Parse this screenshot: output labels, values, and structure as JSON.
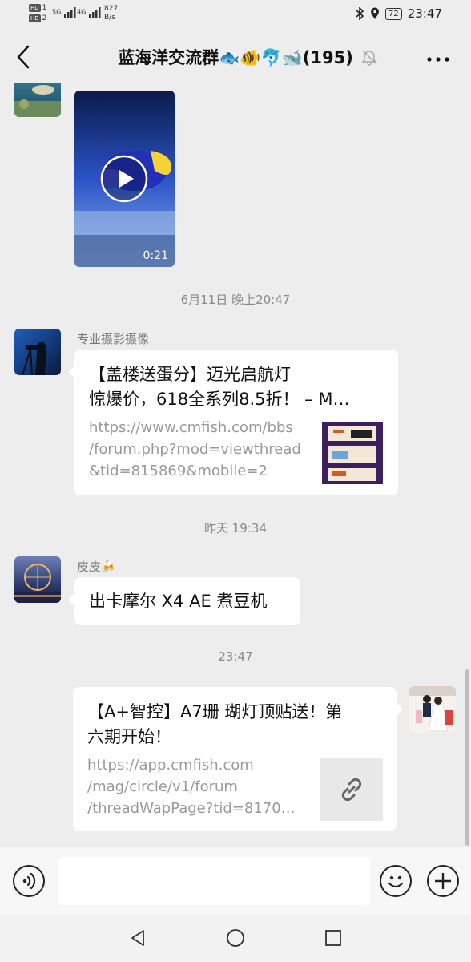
{
  "status_bar": {
    "hd1": "HD",
    "hd1_num": "1",
    "hd2": "HD",
    "hd2_num": "2",
    "sig1": "5G",
    "sig2": "4G",
    "net_speed_value": "827",
    "net_speed_unit": "B/s",
    "battery": "72",
    "time": "23:47"
  },
  "header": {
    "title": "蓝海洋交流群🐟🐠🐬🐋(195)"
  },
  "messages": [
    {
      "type": "video",
      "sender": "",
      "duration": "0:21"
    },
    {
      "type": "timestamp",
      "text": "6月11日 晚上20:47"
    },
    {
      "type": "link_card",
      "sender": "专业摄影摄像",
      "title": "【盖楼送蛋分】迈光启航灯惊爆价，618全系列8.5折！ – M...",
      "title_line1": "【盖楼送蛋分】迈光启航灯",
      "title_line2": "惊爆价，618全系列8.5折！ – M…",
      "url_line1": "https://www.cmfish.com/bbs",
      "url_line2": "/forum.php?mod=viewthread",
      "url_line3": "&tid=815869&mobile=2"
    },
    {
      "type": "timestamp",
      "text": "昨天 19:34"
    },
    {
      "type": "text",
      "sender": "皮皮🍻",
      "text": "出卡摩尔 X4 AE 煮豆机"
    },
    {
      "type": "timestamp",
      "text": "23:47"
    },
    {
      "type": "link_card_self",
      "title_line1": "【A+智控】A7珊 瑚灯顶贴送！第",
      "title_line2": "六期开始！",
      "url_line1": "https://app.cmfish.com",
      "url_line2": "/mag/circle/v1/forum",
      "url_line3": "/threadWapPage?tid=8170…"
    }
  ],
  "input_bar": {
    "placeholder": ""
  },
  "colors": {
    "background": "#ededed",
    "bubble": "#ffffff",
    "timestamp_text": "#888888",
    "url_text": "#999999"
  },
  "icons": {
    "back": "chevron-left-icon",
    "mute": "bell-off-icon",
    "more": "more-dots-icon",
    "voice": "voice-icon",
    "emoji": "emoji-icon",
    "plus": "plus-icon",
    "link": "link-icon",
    "play": "play-icon",
    "nav_back": "nav-back-icon",
    "nav_home": "nav-home-icon",
    "nav_recent": "nav-recent-icon"
  }
}
